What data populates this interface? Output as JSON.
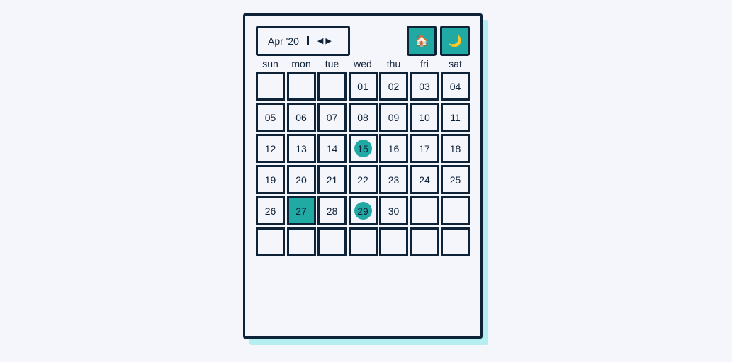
{
  "header": {
    "month_label": "Apr '20",
    "prev_icon": "◀",
    "next_icon": "▶",
    "home_icon": "🏠",
    "theme_icon": "🌙"
  },
  "weekdays": [
    "sun",
    "mon",
    "tue",
    "wed",
    "thu",
    "fri",
    "sat"
  ],
  "cells": [
    "",
    "",
    "",
    "01",
    "02",
    "03",
    "04",
    "05",
    "06",
    "07",
    "08",
    "09",
    "10",
    "11",
    "12",
    "13",
    "14",
    "15",
    "16",
    "17",
    "18",
    "19",
    "20",
    "21",
    "22",
    "23",
    "24",
    "25",
    "26",
    "27",
    "28",
    "29",
    "30",
    "",
    "",
    "",
    "",
    "",
    "",
    "",
    "",
    ""
  ],
  "selected_day": "27",
  "marked_days": [
    "15",
    "29"
  ],
  "colors": {
    "accent": "#20aaa3",
    "border": "#0e2238",
    "shadow": "#b5eef0"
  }
}
